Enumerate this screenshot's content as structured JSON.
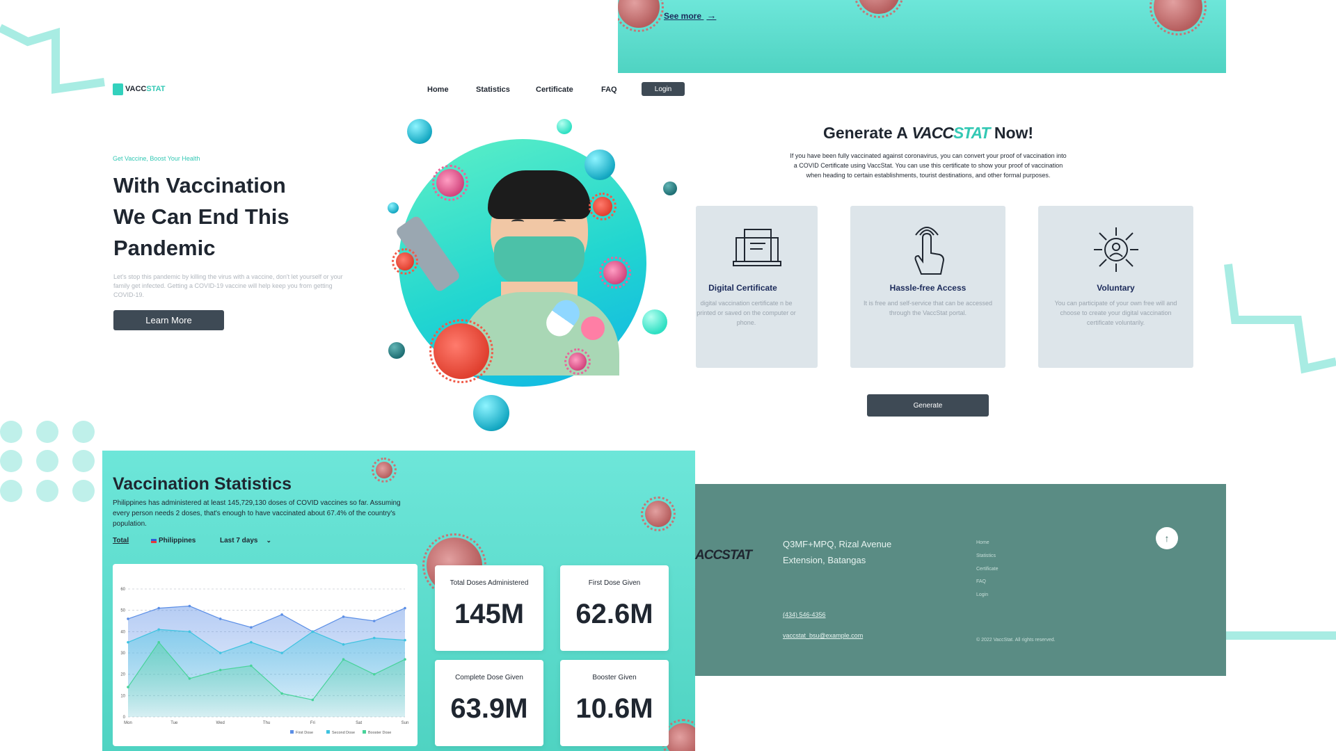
{
  "top_banner": {
    "see_more": "See more"
  },
  "header": {
    "brand_a": "VACC",
    "brand_b": "STAT",
    "nav": [
      "Home",
      "Statistics",
      "Certificate",
      "FAQ"
    ],
    "login": "Login"
  },
  "hero": {
    "eyebrow": "Get Vaccine, Boost Your Health",
    "title_lines": [
      "With Vaccination",
      "We Can End This",
      "Pandemic"
    ],
    "description": "Let's stop this pandemic by killing the virus with a vaccine, don't let yourself or your family get infected. Getting a COVID-19 vaccine will help keep you from getting COVID-19.",
    "cta": "Learn More"
  },
  "generate": {
    "title_pre": "Generate A",
    "title_brand_a": "VACC",
    "title_brand_b": "STAT",
    "title_post": "Now!",
    "description": "If you have been fully vaccinated against coronavirus, you can convert your proof of vaccination into a COVID Certificate using VaccStat. You can use this certificate to show your proof of vaccination when heading to certain establishments, tourist destinations, and other formal purposes.",
    "cards": [
      {
        "title": "Digital Certificate",
        "desc": "digital vaccination certificate n be printed or saved on the computer or phone.",
        "icon": "certificate-icon"
      },
      {
        "title": "Hassle-free Access",
        "desc": "It is free and self-service that can be accessed through the VaccStat portal.",
        "icon": "hand-touch-icon"
      },
      {
        "title": "Voluntary",
        "desc": "You can participate of your own free will and choose to create your digital vaccination certificate voluntarily.",
        "icon": "person-arrows-icon"
      }
    ],
    "button": "Generate"
  },
  "statistics": {
    "title": "Vaccination Statistics",
    "description": "Philippines has administered at least 145,729,130 doses of COVID vaccines so far. Assuming every person needs 2 doses, that's enough to have vaccinated about 67.4% of the country's population.",
    "filters": {
      "total": "Total",
      "country": "Philippines",
      "range": "Last 7 days"
    },
    "cards": [
      {
        "label": "Total Doses Administered",
        "value": "145M"
      },
      {
        "label": "First Dose Given",
        "value": "62.6M"
      },
      {
        "label": "Complete Dose Given",
        "value": "63.9M"
      },
      {
        "label": "Booster Given",
        "value": "10.6M"
      }
    ]
  },
  "chart_data": {
    "type": "area",
    "x": [
      "Mon",
      "Tue",
      "Wed",
      "Thu",
      "Fri",
      "Sat",
      "Sun"
    ],
    "ylim": [
      0,
      60
    ],
    "yticks": [
      0,
      10,
      20,
      30,
      40,
      50,
      60
    ],
    "series": [
      {
        "name": "First Dose",
        "color": "#5b8ee6",
        "values": [
          46,
          51,
          52,
          46,
          42,
          48,
          40,
          47,
          45,
          51
        ]
      },
      {
        "name": "Second Dose",
        "color": "#3fc3e0",
        "values": [
          35,
          41,
          40,
          30,
          35,
          30,
          40,
          34,
          37,
          36
        ]
      },
      {
        "name": "Booster Dose",
        "color": "#48d39a",
        "values": [
          14,
          35,
          18,
          22,
          24,
          11,
          8,
          27,
          20,
          27
        ]
      }
    ],
    "legend_position": "bottom",
    "grid": true
  },
  "footer": {
    "brand_partial": "ACCSTAT",
    "address": "Q3MF+MPQ, Rizal Avenue Extension, Batangas",
    "phone": "(434) 546-4356",
    "email": "vaccstat_bsu@example.com",
    "links": [
      "Home",
      "Statistics",
      "Certificate",
      "FAQ",
      "Login"
    ],
    "copyright": "© 2022 VaccStat. All rights reserved."
  }
}
